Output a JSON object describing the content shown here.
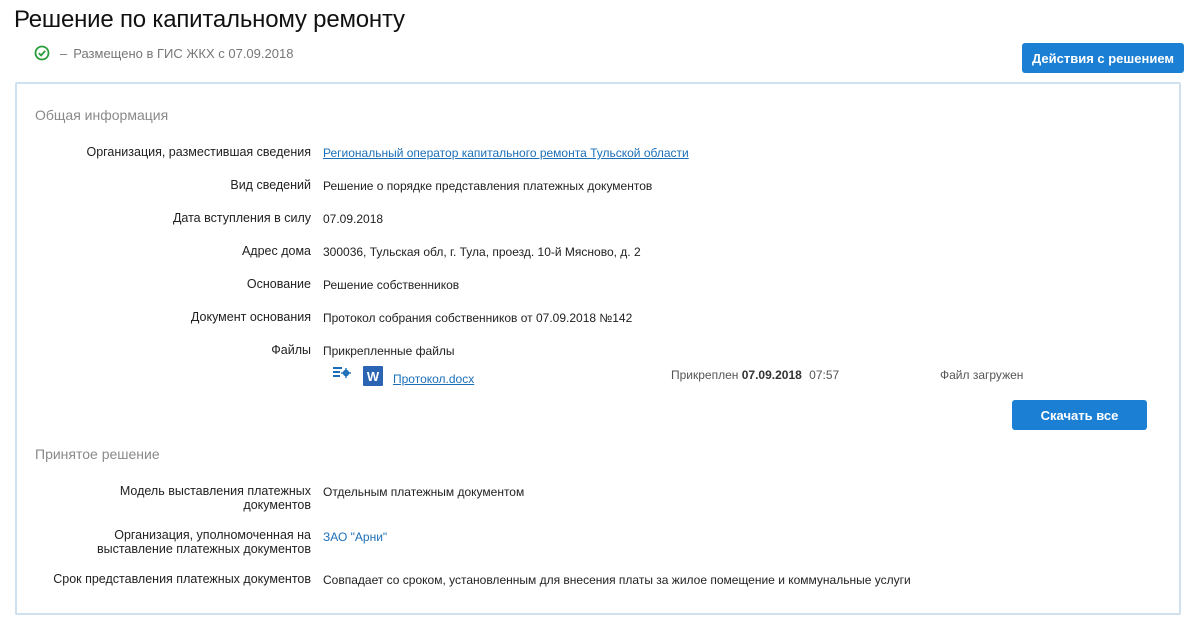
{
  "page": {
    "title": "Решение по капитальному ремонту",
    "status_dash": "–",
    "status_text": "Размещено в ГИС ЖКХ с 07.09.2018",
    "actions_button": "Действия с решением"
  },
  "general": {
    "section_title": "Общая информация",
    "rows": [
      {
        "label": "Организация, разместившая сведения",
        "value": "Региональный оператор капитального ремонта Тульской области"
      },
      {
        "label": "Вид сведений",
        "value": "Решение о порядке представления платежных документов"
      },
      {
        "label": "Дата вступления в силу",
        "value": "07.09.2018"
      },
      {
        "label": "Адрес дома",
        "value": "300036, Тульская обл, г. Тула, проезд. 10-й Мясново, д. 2"
      },
      {
        "label": "Основание",
        "value": "Решение собственников"
      },
      {
        "label": "Документ основания",
        "value": "Протокол собрания собственников от 07.09.2018 №142"
      },
      {
        "label": "Файлы",
        "value": "Прикрепленные файлы"
      }
    ],
    "file": {
      "name": "Протокол.docx",
      "word_letter": "W",
      "attached_prefix": "Прикреплен",
      "attached_date": "07.09.2018",
      "attached_time": "07:57",
      "status": "Файл загружен",
      "icons": [
        "settings-doc-icon",
        "word-icon"
      ]
    },
    "download_all": "Скачать все"
  },
  "decision": {
    "section_title": "Принятое решение",
    "rows": [
      {
        "label_line1": "Модель выставления платежных",
        "label_line2": "документов",
        "value": "Отдельным платежным документом"
      },
      {
        "label_line1": "Организация, уполномоченная на",
        "label_line2": "выставление платежных документов",
        "value": "ЗАО \"Арни\""
      },
      {
        "label": "Срок представления платежных документов",
        "value": "Совпадает со сроком, установленным для внесения платы за жилое помещение и коммунальные услуги"
      }
    ]
  },
  "colors": {
    "accent": "#1b7fd4",
    "link": "#1b6fb8",
    "check": "#2a9d3a",
    "card_border": "#cfe1ee"
  }
}
